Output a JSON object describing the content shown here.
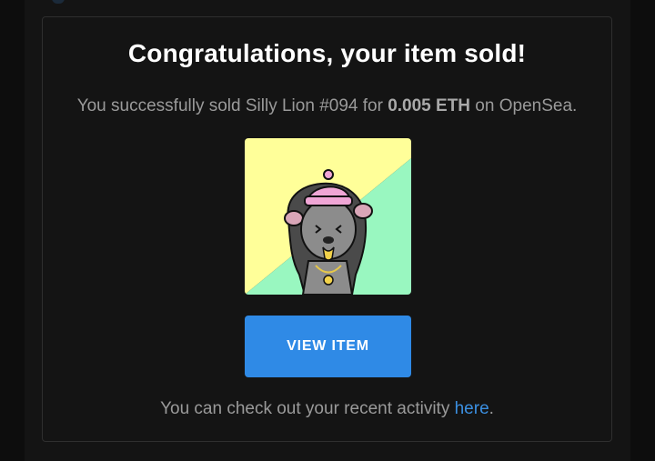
{
  "email": {
    "title": "Congratulations, your item sold!",
    "sale": {
      "prefix": "You successfully sold ",
      "item_name": "Silly Lion #094",
      "for_text": " for ",
      "price": "0.005 ETH",
      "on_text": " on ",
      "marketplace": "OpenSea",
      "suffix": "."
    },
    "image": {
      "bg_yellow": "#ffff99",
      "bg_green": "#99f7c0"
    },
    "button_label": "VIEW ITEM",
    "footer": {
      "prefix": "You can check out your recent activity ",
      "link_text": "here",
      "suffix": "."
    },
    "colors": {
      "accent": "#2f8ae6",
      "link": "#3b8fe0"
    }
  }
}
